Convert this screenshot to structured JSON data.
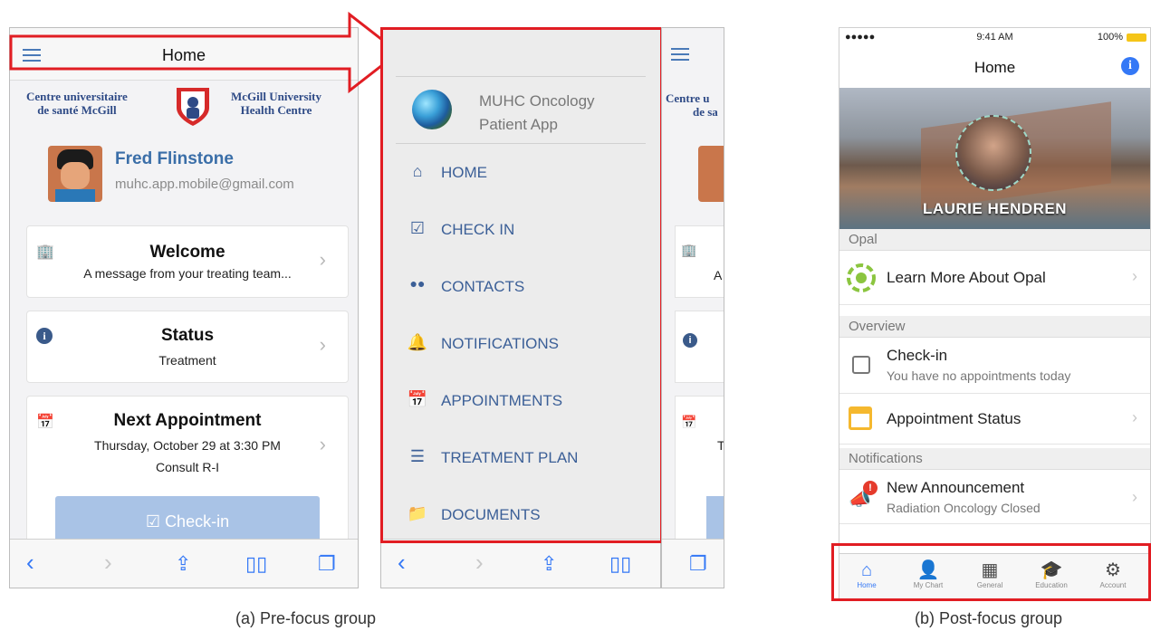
{
  "pre": {
    "header_title": "Home",
    "logo_left_1": "Centre universitaire",
    "logo_left_2": "de santé McGill",
    "logo_right_1": "McGill University",
    "logo_right_2": "Health Centre",
    "profile_name": "Fred Flinstone",
    "profile_email": "muhc.app.mobile@gmail.com",
    "cards": [
      {
        "title": "Welcome",
        "subtitle": "A message from your treating team...",
        "subtitle2": "",
        "icon": "building-icon"
      },
      {
        "title": "Status",
        "subtitle": "Treatment",
        "subtitle2": "",
        "icon": "info-icon"
      },
      {
        "title": "Next Appointment",
        "subtitle": "Thursday, October 29 at 3:30 PM",
        "subtitle2": "Consult R-I",
        "icon": "calendar-icon"
      }
    ],
    "checkin_label": "Check-in",
    "partial_logo_1": "Centre u",
    "partial_logo_2": "de sa",
    "partial_welcome": "A m",
    "partial_appt": "Th"
  },
  "menu": {
    "app_name_1": "MUHC Oncology",
    "app_name_2": "Patient App",
    "items": [
      {
        "label": "HOME",
        "icon": "home-icon"
      },
      {
        "label": "CHECK IN",
        "icon": "checkbox-icon"
      },
      {
        "label": "CONTACTS",
        "icon": "contacts-icon"
      },
      {
        "label": "NOTIFICATIONS",
        "icon": "bell-icon"
      },
      {
        "label": "APPOINTMENTS",
        "icon": "calendar-icon"
      },
      {
        "label": "TREATMENT PLAN",
        "icon": "list-icon"
      },
      {
        "label": "DOCUMENTS",
        "icon": "folder-icon"
      }
    ]
  },
  "post": {
    "status_carrier": "●●●●● ",
    "status_time": "9:41 AM",
    "status_battery": "100%",
    "title": "Home",
    "hero_name": "LAURIE HENDREN",
    "sections": [
      "Opal",
      "Overview",
      "Notifications"
    ],
    "rows": [
      {
        "title": "Learn More About Opal",
        "subtitle": ""
      },
      {
        "title": "Check-in",
        "subtitle": "You have no appointments today"
      },
      {
        "title": "Appointment Status",
        "subtitle": ""
      },
      {
        "title": "New Announcement",
        "subtitle": "Radiation Oncology Closed"
      }
    ],
    "tabs": [
      {
        "label": "Home",
        "icon": "home-icon"
      },
      {
        "label": "My Chart",
        "icon": "person-icon"
      },
      {
        "label": "General",
        "icon": "grid-icon"
      },
      {
        "label": "Education",
        "icon": "graduation-cap-icon"
      },
      {
        "label": "Account",
        "icon": "gear-icon"
      }
    ]
  },
  "captions": {
    "a": "(a) Pre-focus group",
    "b": "(b) Post-focus group"
  },
  "colors": {
    "highlight": "#e11d23",
    "accent": "#3478f6",
    "menu_text": "#3b5f97"
  }
}
